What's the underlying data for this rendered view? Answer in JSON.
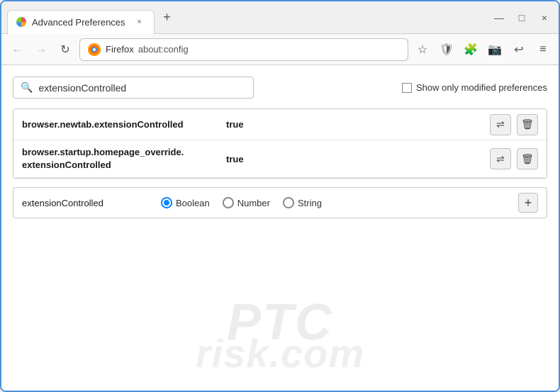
{
  "window": {
    "title": "Advanced Preferences",
    "tab_close": "×",
    "new_tab": "+",
    "win_minimize": "—",
    "win_maximize": "□",
    "win_close": "×"
  },
  "nav": {
    "back_label": "←",
    "forward_label": "→",
    "refresh_label": "↻",
    "firefox_label": "Firefox",
    "url": "about:config",
    "bookmark_icon": "☆",
    "shield_icon": "🛡",
    "extension_icon": "🧩",
    "camera_icon": "📷",
    "history_icon": "↩",
    "menu_icon": "≡"
  },
  "search": {
    "placeholder": "extensionControlled",
    "value": "extensionControlled",
    "show_modified_label": "Show only modified preferences"
  },
  "preferences": [
    {
      "name": "browser.newtab.extensionControlled",
      "value": "true",
      "multiline": false
    },
    {
      "name_line1": "browser.startup.homepage_override.",
      "name_line2": "extensionControlled",
      "value": "true",
      "multiline": true
    }
  ],
  "new_pref_row": {
    "name": "extensionControlled",
    "radio_options": [
      {
        "label": "Boolean",
        "selected": true
      },
      {
        "label": "Number",
        "selected": false
      },
      {
        "label": "String",
        "selected": false
      }
    ],
    "add_btn_label": "+"
  },
  "watermark": {
    "line1": "PTC",
    "line2": "risk.com"
  },
  "icons": {
    "swap": "⇌",
    "trash": "🗑",
    "search": "🔍"
  }
}
